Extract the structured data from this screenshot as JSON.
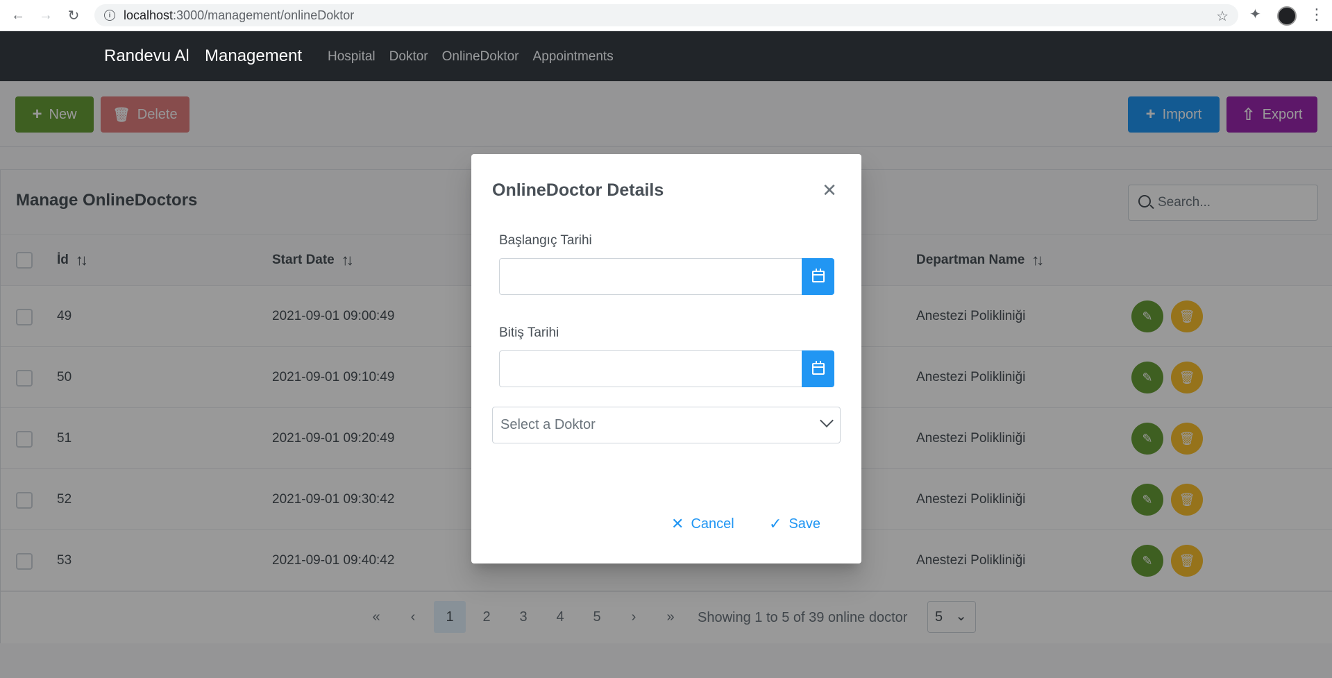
{
  "browser": {
    "url_host": "localhost",
    "url_path": ":3000/management/onlineDoktor"
  },
  "navbar": {
    "brand": "Randevu Al",
    "section": "Management",
    "links": [
      "Hospital",
      "Doktor",
      "OnlineDoktor",
      "Appointments"
    ]
  },
  "toolbar": {
    "new_label": "New",
    "delete_label": "Delete",
    "import_label": "Import",
    "export_label": "Export"
  },
  "table": {
    "title": "Manage OnlineDoctors",
    "search_placeholder": "Search...",
    "columns": {
      "id": "İd",
      "start_date": "Start Date",
      "departman": "Departman Name"
    },
    "rows": [
      {
        "id": "49",
        "start": "2021-09-01 09:00:49",
        "departman": "Anestezi Polikliniği"
      },
      {
        "id": "50",
        "start": "2021-09-01 09:10:49",
        "departman": "Anestezi Polikliniği"
      },
      {
        "id": "51",
        "start": "2021-09-01 09:20:49",
        "departman": "Anestezi Polikliniği"
      },
      {
        "id": "52",
        "start": "2021-09-01 09:30:42",
        "departman": "Anestezi Polikliniği"
      },
      {
        "id": "53",
        "start": "2021-09-01 09:40:42",
        "departman": "Anestezi Polikliniği"
      }
    ]
  },
  "paginator": {
    "first": "«",
    "prev": "‹",
    "pages": [
      "1",
      "2",
      "3",
      "4",
      "5"
    ],
    "active_page": "1",
    "next": "›",
    "last": "»",
    "report": "Showing 1 to 5 of 39 online doctor",
    "rows_per_page": "5"
  },
  "dialog": {
    "title": "OnlineDoctor Details",
    "start_label": "Başlangıç Tarihi",
    "end_label": "Bitiş Tarihi",
    "doktor_placeholder": "Select a Doktor",
    "cancel_label": "Cancel",
    "save_label": "Save"
  },
  "colors": {
    "success": "#689f38",
    "danger": "#d32f2f",
    "info": "#2196f3",
    "help": "#9c27b0",
    "warning": "#fbc02d",
    "navbar": "#212529"
  }
}
